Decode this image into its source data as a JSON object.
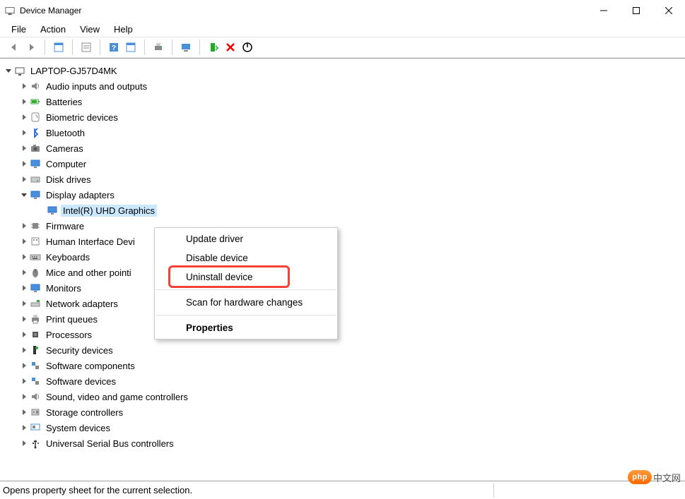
{
  "title": "Device Manager",
  "menus": {
    "file": "File",
    "action": "Action",
    "view": "View",
    "help": "Help"
  },
  "computer_name": "LAPTOP-GJ57D4MK",
  "categories": [
    {
      "label": "Audio inputs and outputs",
      "icon": "speaker"
    },
    {
      "label": "Batteries",
      "icon": "battery"
    },
    {
      "label": "Biometric devices",
      "icon": "fingerprint"
    },
    {
      "label": "Bluetooth",
      "icon": "bluetooth"
    },
    {
      "label": "Cameras",
      "icon": "camera"
    },
    {
      "label": "Computer",
      "icon": "monitor"
    },
    {
      "label": "Disk drives",
      "icon": "disk"
    },
    {
      "label": "Display adapters",
      "icon": "monitor",
      "expanded": true,
      "children": [
        {
          "label": "Intel(R) UHD Graphics",
          "icon": "monitor",
          "selected": true
        }
      ]
    },
    {
      "label": "Firmware",
      "icon": "chip"
    },
    {
      "label": "Human Interface Devi",
      "icon": "hid"
    },
    {
      "label": "Keyboards",
      "icon": "keyboard"
    },
    {
      "label": "Mice and other pointi",
      "icon": "mouse"
    },
    {
      "label": "Monitors",
      "icon": "monitor"
    },
    {
      "label": "Network adapters",
      "icon": "network"
    },
    {
      "label": "Print queues",
      "icon": "printer"
    },
    {
      "label": "Processors",
      "icon": "cpu"
    },
    {
      "label": "Security devices",
      "icon": "security"
    },
    {
      "label": "Software components",
      "icon": "component"
    },
    {
      "label": "Software devices",
      "icon": "component"
    },
    {
      "label": "Sound, video and game controllers",
      "icon": "speaker"
    },
    {
      "label": "Storage controllers",
      "icon": "storage"
    },
    {
      "label": "System devices",
      "icon": "system"
    },
    {
      "label": "Universal Serial Bus controllers",
      "icon": "usb"
    }
  ],
  "context_menu": {
    "update": "Update driver",
    "disable": "Disable device",
    "uninstall": "Uninstall device",
    "scan": "Scan for hardware changes",
    "properties": "Properties"
  },
  "statusbar": "Opens property sheet for the current selection.",
  "watermark": {
    "badge": "php",
    "text": "中文网"
  }
}
